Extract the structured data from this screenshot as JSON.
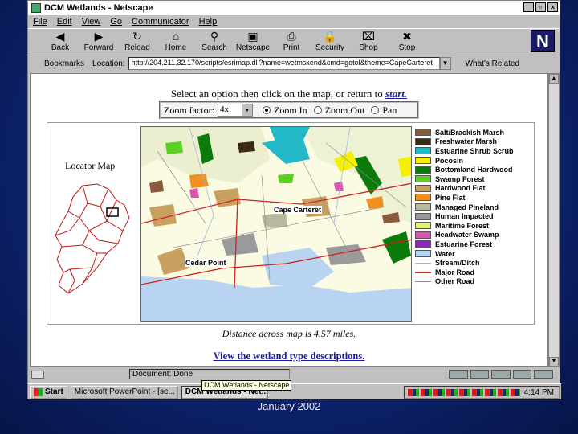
{
  "window": {
    "title": "DCM Wetlands - Netscape"
  },
  "menu": [
    "File",
    "Edit",
    "View",
    "Go",
    "Communicator",
    "Help"
  ],
  "toolbar": [
    {
      "label": "Back",
      "icon": "back-arrow-icon",
      "glyph": "◀"
    },
    {
      "label": "Forward",
      "icon": "forward-arrow-icon",
      "glyph": "▶"
    },
    {
      "label": "Reload",
      "icon": "reload-icon",
      "glyph": "↻"
    },
    {
      "label": "Home",
      "icon": "home-icon",
      "glyph": "⌂"
    },
    {
      "label": "Search",
      "icon": "search-icon",
      "glyph": "⚲"
    },
    {
      "label": "Netscape",
      "icon": "netscape-icon",
      "glyph": "▣"
    },
    {
      "label": "Print",
      "icon": "print-icon",
      "glyph": "⎙"
    },
    {
      "label": "Security",
      "icon": "lock-icon",
      "glyph": "🔒"
    },
    {
      "label": "Shop",
      "icon": "shop-icon",
      "glyph": "⌧"
    },
    {
      "label": "Stop",
      "icon": "stop-icon",
      "glyph": "✖"
    }
  ],
  "location": {
    "bookmarks_label": "Bookmarks",
    "label": "Location:",
    "url": "http://204.211.32.170/scripts/esrimap.dll?name=wetmskend&cmd=gotol&theme=CapeCarteret",
    "related_label": "What's Related"
  },
  "page": {
    "instruction_prefix": "Select an option then click on the map, or return to",
    "instruction_link": "start.",
    "zoom_factor_label": "Zoom factor:",
    "zoom_factor_value": "4x",
    "modes": [
      {
        "label": "Zoom In",
        "selected": true
      },
      {
        "label": "Zoom Out",
        "selected": false
      },
      {
        "label": "Pan",
        "selected": false
      }
    ],
    "locator_title": "Locator Map",
    "map_labels": {
      "town1": "Cape Carteret",
      "town2": "Cedar Point"
    },
    "distance_text": "Distance across map is 4.57 miles.",
    "desc_link": "View the wetland type descriptions."
  },
  "legend": [
    {
      "label": "Salt/Brackish Marsh",
      "color": "#8b5a3c",
      "kind": "swatch"
    },
    {
      "label": "Freshwater Marsh",
      "color": "#3a2a16",
      "kind": "swatch"
    },
    {
      "label": "Estuarine Shrub Scrub",
      "color": "#22b8c8",
      "kind": "swatch"
    },
    {
      "label": "Pocosin",
      "color": "#f4f000",
      "kind": "swatch"
    },
    {
      "label": "Bottomland Hardwood",
      "color": "#0a7a0a",
      "kind": "swatch"
    },
    {
      "label": "Swamp Forest",
      "color": "#5ad020",
      "kind": "swatch"
    },
    {
      "label": "Hardwood Flat",
      "color": "#c8a060",
      "kind": "swatch"
    },
    {
      "label": "Pine Flat",
      "color": "#f09020",
      "kind": "swatch"
    },
    {
      "label": "Managed Pineland",
      "color": "#b8b8a0",
      "kind": "swatch"
    },
    {
      "label": "Human Impacted",
      "color": "#9a9a9a",
      "kind": "swatch"
    },
    {
      "label": "Maritime Forest",
      "color": "#e8f070",
      "kind": "swatch"
    },
    {
      "label": "Headwater Swamp",
      "color": "#e050b0",
      "kind": "swatch"
    },
    {
      "label": "Estuarine Forest",
      "color": "#8a2ab8",
      "kind": "swatch"
    },
    {
      "label": "Water",
      "color": "#b8d4f0",
      "kind": "swatch"
    },
    {
      "label": "Stream/Ditch",
      "color": "#9ab8e0",
      "kind": "line"
    },
    {
      "label": "Major Road",
      "color": "#d02020",
      "kind": "line"
    },
    {
      "label": "Other Road",
      "color": "#909090",
      "kind": "line"
    }
  ],
  "status": {
    "text": "Document: Done",
    "tooltip": "DCM Wetlands - Netscape"
  },
  "taskbar": {
    "start_label": "Start",
    "tasks": [
      {
        "label": "Microsoft PowerPoint - [se...",
        "active": false
      },
      {
        "label": "DCM Wetlands - Net...",
        "active": true
      }
    ],
    "clock": "4:14 PM"
  },
  "footer": "January 2002"
}
